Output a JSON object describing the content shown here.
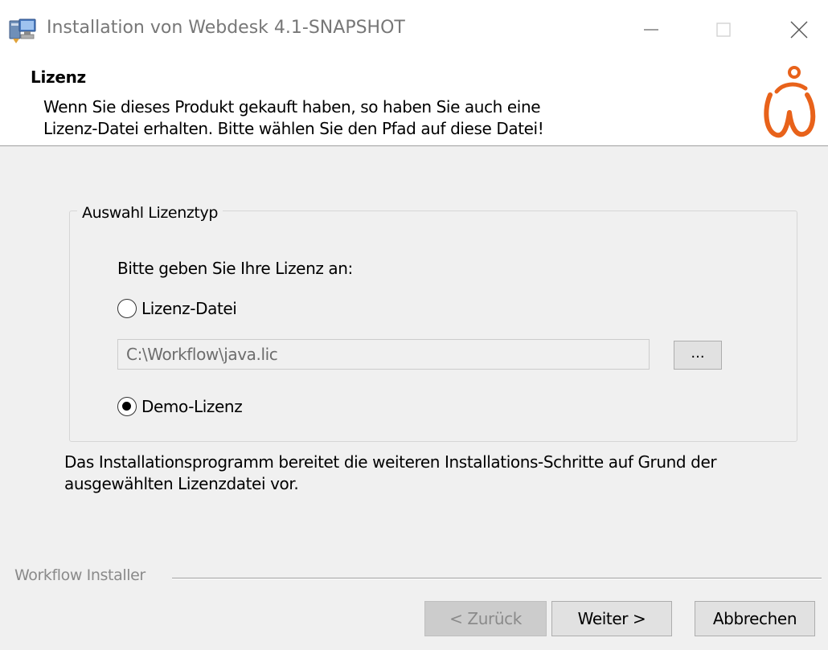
{
  "window": {
    "title": "Installation von Webdesk 4.1-SNAPSHOT",
    "app_icon": "installer-computer-icon",
    "controls": [
      "minimize-icon",
      "maximize-icon",
      "close-icon"
    ]
  },
  "header": {
    "title": "Lizenz",
    "description_lines": [
      "Wenn Sie dieses Produkt gekauft haben, so haben Sie auch eine",
      "Lizenz-Datei erhalten. Bitte wählen Sie den Pfad auf diese Datei!"
    ],
    "logo_icon": "webdesk-logo-icon",
    "logo_color": "#e8621a"
  },
  "license_group": {
    "legend": "Auswahl Lizenztyp",
    "prompt": "Bitte geben Sie Ihre Lizenz an:",
    "option_file": {
      "label": "Lizenz-Datei",
      "checked": false
    },
    "path_value": "C:\\Workflow\\java.lic",
    "browse_label": "...",
    "option_demo": {
      "label": "Demo-Lizenz",
      "checked": true
    }
  },
  "info_lines": [
    "Das Installationsprogramm bereitet die weiteren Installations-Schritte auf Grund der",
    "ausgewählten Lizenzdatei vor."
  ],
  "footer": {
    "brand": "Workflow Installer",
    "back_label": "< Zurück",
    "next_label": "Weiter >",
    "cancel_label": "Abbrechen"
  }
}
